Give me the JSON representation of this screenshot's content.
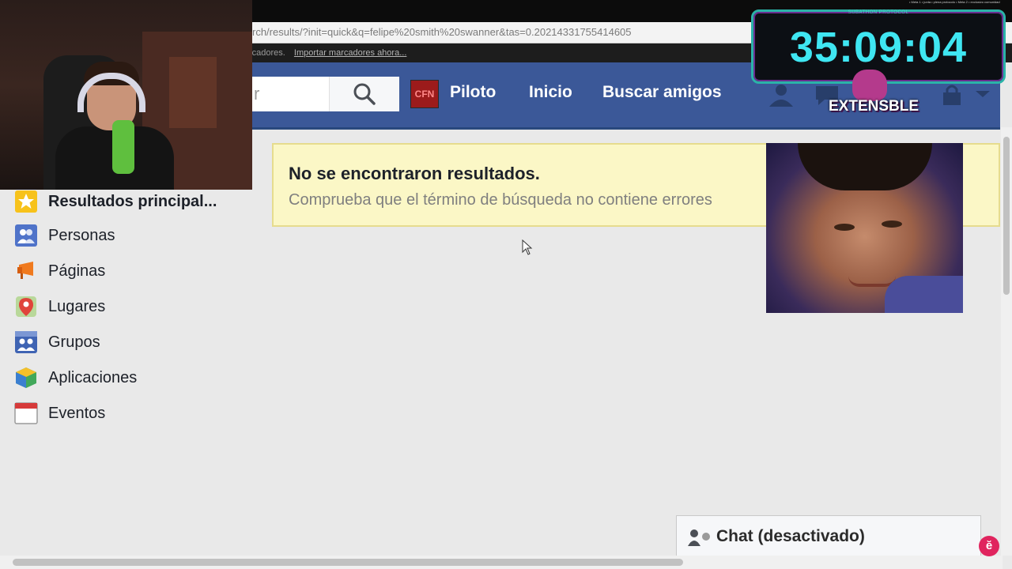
{
  "browser": {
    "url": "rch/results/?init=quick&q=felipe%20smith%20swanner&tas=0.20214331755414605",
    "bookmarks_prefix": "rcadores.",
    "bookmarks_link": "Importar marcadores ahora..."
  },
  "header": {
    "search_value": "r",
    "profile_name": "Piloto",
    "profile_avatar_text": "CFN",
    "nav_home": "Inicio",
    "nav_find_friends": "Buscar amigos"
  },
  "sidebar": {
    "items": [
      {
        "label": "Resultados principal...",
        "icon": "star-icon"
      },
      {
        "label": "Personas",
        "icon": "people-icon"
      },
      {
        "label": "Páginas",
        "icon": "flag-icon"
      },
      {
        "label": "Lugares",
        "icon": "map-pin-icon"
      },
      {
        "label": "Grupos",
        "icon": "groups-icon"
      },
      {
        "label": "Aplicaciones",
        "icon": "apps-icon"
      },
      {
        "label": "Eventos",
        "icon": "calendar-icon"
      }
    ]
  },
  "results": {
    "title": "No se encontraron resultados.",
    "subtitle": "Comprueba que el término de búsqueda no contiene errores"
  },
  "chat": {
    "label": "Chat (desactivado)"
  },
  "overlay": {
    "timer_header": "SUBATHON PROTOCOL",
    "timer": "35:09:04",
    "brand": "EXTENSBLE",
    "top_note": "• Meta 1 • junta • plena protocolo • Meta 2 • exclusivo comunidad"
  },
  "colors": {
    "facebook_blue": "#3b5898",
    "notice_bg": "#fbf7c6",
    "timer_text": "#3fe6f2"
  }
}
